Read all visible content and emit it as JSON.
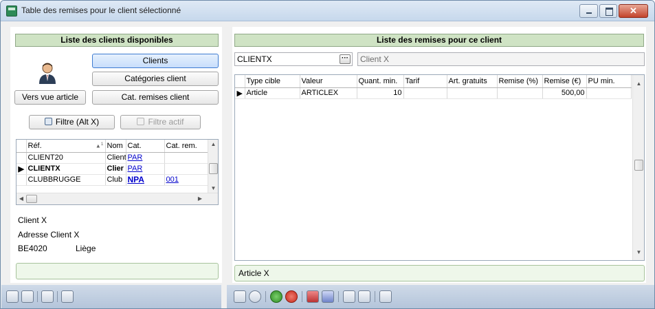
{
  "window": {
    "title": "Table des remises pour le client sélectionné",
    "close_glyph": "✕"
  },
  "left": {
    "header": "Liste des clients disponibles",
    "btn_clients": "Clients",
    "btn_categories": "Catégories client",
    "btn_vers_vue": "Vers vue article",
    "btn_cat_remises": "Cat. remises client",
    "btn_filtre": "Filtre (Alt X)",
    "btn_filtre_actif": "Filtre actif",
    "grid": {
      "columns": [
        "Réf.",
        "Nom",
        "Cat.",
        "Cat. rem."
      ],
      "sort_index": "1",
      "rows": [
        {
          "ref": "CLIENT20",
          "nom": "Client",
          "cat": "PAR",
          "catrem": ""
        },
        {
          "ref": "CLIENTX",
          "nom": "Clier",
          "cat": "PAR",
          "catrem": ""
        },
        {
          "ref": "CLUBBRUGGE",
          "nom": "Club",
          "cat": "NPA",
          "catrem": "001"
        }
      ]
    },
    "info": {
      "name": "Client X",
      "address": "Adresse Client X",
      "postal": "BE4020",
      "city": "Liège"
    },
    "status": ""
  },
  "right": {
    "header": "Liste des remises pour ce client",
    "client_code": "CLIENTX",
    "client_name": "Client X",
    "lookup_glyph": "···",
    "grid": {
      "columns": [
        "Type cible",
        "Valeur",
        "Quant. min.",
        "Tarif",
        "Art. gratuits",
        "Remise (%)",
        "Remise (€)",
        "PU min."
      ],
      "rows": [
        {
          "type": "Article",
          "valeur": "ARTICLEX",
          "qmin": "10",
          "tarif": "",
          "gratuits": "",
          "remise_pct": "",
          "remise_eur": "500,00",
          "pumin": ""
        }
      ]
    },
    "status": "Article X"
  },
  "colors": {
    "header_bg": "#cfe3c4",
    "status_bg": "#eef7ea",
    "toolbar_bg": "#c2d0e2",
    "selected_btn": "#c7ddfb",
    "link": "#0000cc"
  },
  "toolbar_left_icons": [
    "copy-icon",
    "paste-icon",
    "pin-icon",
    "pen-icon"
  ],
  "toolbar_right_icons": [
    "print-icon",
    "refresh-icon",
    "add-icon",
    "delete-icon",
    "book-icon",
    "view-icon",
    "copy-icon",
    "paste-icon",
    "arrow-down-icon"
  ]
}
